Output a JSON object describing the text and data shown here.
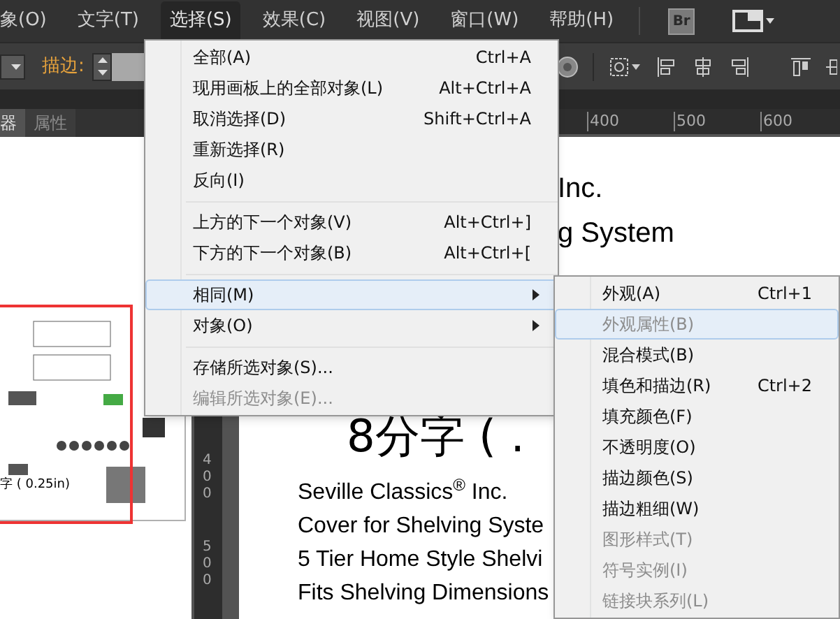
{
  "menubar": [
    {
      "label": "象(O)",
      "selected": false
    },
    {
      "label": "文字(T)",
      "selected": false
    },
    {
      "label": "选择(S)",
      "selected": true
    },
    {
      "label": "效果(C)",
      "selected": false
    },
    {
      "label": "视图(V)",
      "selected": false
    },
    {
      "label": "窗口(W)",
      "selected": false
    },
    {
      "label": "帮助(H)",
      "selected": false
    }
  ],
  "bridge_button": "Br",
  "toolbar": {
    "stroke_label": "描边:"
  },
  "panel_tabs": [
    {
      "label": "器",
      "selected": true
    },
    {
      "label": "属性",
      "selected": false
    }
  ],
  "navigator": {
    "caption": "字 ( 0.25in)"
  },
  "ruler": {
    "horizontal": [
      "400",
      "500",
      "600"
    ],
    "vertical": [
      "400",
      "500"
    ]
  },
  "document": {
    "top_lines": [
      "Inc.",
      "g System"
    ],
    "heading": "8分字 ( .",
    "lines": [
      "Seville Classics$^{®}$ Inc.",
      "Cover for Shelving Syste",
      "5 Tier Home Style Shelvi",
      "Fits Shelving Dimensions"
    ]
  },
  "select_menu": [
    {
      "kind": "item",
      "label": "全部(A)",
      "shortcut": "Ctrl+A",
      "disabled": false,
      "highlighted": false,
      "submenu": false
    },
    {
      "kind": "item",
      "label": "现用画板上的全部对象(L)",
      "shortcut": "Alt+Ctrl+A",
      "disabled": false,
      "highlighted": false,
      "submenu": false
    },
    {
      "kind": "item",
      "label": "取消选择(D)",
      "shortcut": "Shift+Ctrl+A",
      "disabled": false,
      "highlighted": false,
      "submenu": false
    },
    {
      "kind": "item",
      "label": "重新选择(R)",
      "disabled": false,
      "highlighted": false,
      "submenu": false
    },
    {
      "kind": "item",
      "label": "反向(I)",
      "disabled": false,
      "highlighted": false,
      "submenu": false
    },
    {
      "kind": "separator"
    },
    {
      "kind": "item",
      "label": "上方的下一个对象(V)",
      "shortcut": "Alt+Ctrl+]",
      "disabled": false,
      "highlighted": false,
      "submenu": false
    },
    {
      "kind": "item",
      "label": "下方的下一个对象(B)",
      "shortcut": "Alt+Ctrl+[",
      "disabled": false,
      "highlighted": false,
      "submenu": false
    },
    {
      "kind": "separator"
    },
    {
      "kind": "item",
      "label": "相同(M)",
      "disabled": false,
      "highlighted": true,
      "submenu": true
    },
    {
      "kind": "item",
      "label": "对象(O)",
      "disabled": false,
      "highlighted": false,
      "submenu": true
    },
    {
      "kind": "separator"
    },
    {
      "kind": "item",
      "label": "存储所选对象(S)...",
      "disabled": false,
      "highlighted": false,
      "submenu": false
    },
    {
      "kind": "item",
      "label": "编辑所选对象(E)...",
      "disabled": true,
      "highlighted": false,
      "submenu": false
    }
  ],
  "same_submenu": [
    {
      "kind": "item",
      "label": "外观(A)",
      "shortcut": "Ctrl+1",
      "disabled": false,
      "highlighted": false
    },
    {
      "kind": "item",
      "label": "外观属性(B)",
      "disabled": true,
      "highlighted": true
    },
    {
      "kind": "item",
      "label": "混合模式(B)",
      "disabled": false,
      "highlighted": false
    },
    {
      "kind": "item",
      "label": "填色和描边(R)",
      "shortcut": "Ctrl+2",
      "disabled": false,
      "highlighted": false
    },
    {
      "kind": "item",
      "label": "填充颜色(F)",
      "disabled": false,
      "highlighted": false
    },
    {
      "kind": "item",
      "label": "不透明度(O)",
      "disabled": false,
      "highlighted": false
    },
    {
      "kind": "item",
      "label": "描边颜色(S)",
      "disabled": false,
      "highlighted": false
    },
    {
      "kind": "item",
      "label": "描边粗细(W)",
      "disabled": false,
      "highlighted": false
    },
    {
      "kind": "item",
      "label": "图形样式(T)",
      "disabled": true,
      "highlighted": false
    },
    {
      "kind": "item",
      "label": "符号实例(I)",
      "disabled": true,
      "highlighted": false
    },
    {
      "kind": "item",
      "label": "链接块系列(L)",
      "disabled": true,
      "highlighted": false
    }
  ]
}
